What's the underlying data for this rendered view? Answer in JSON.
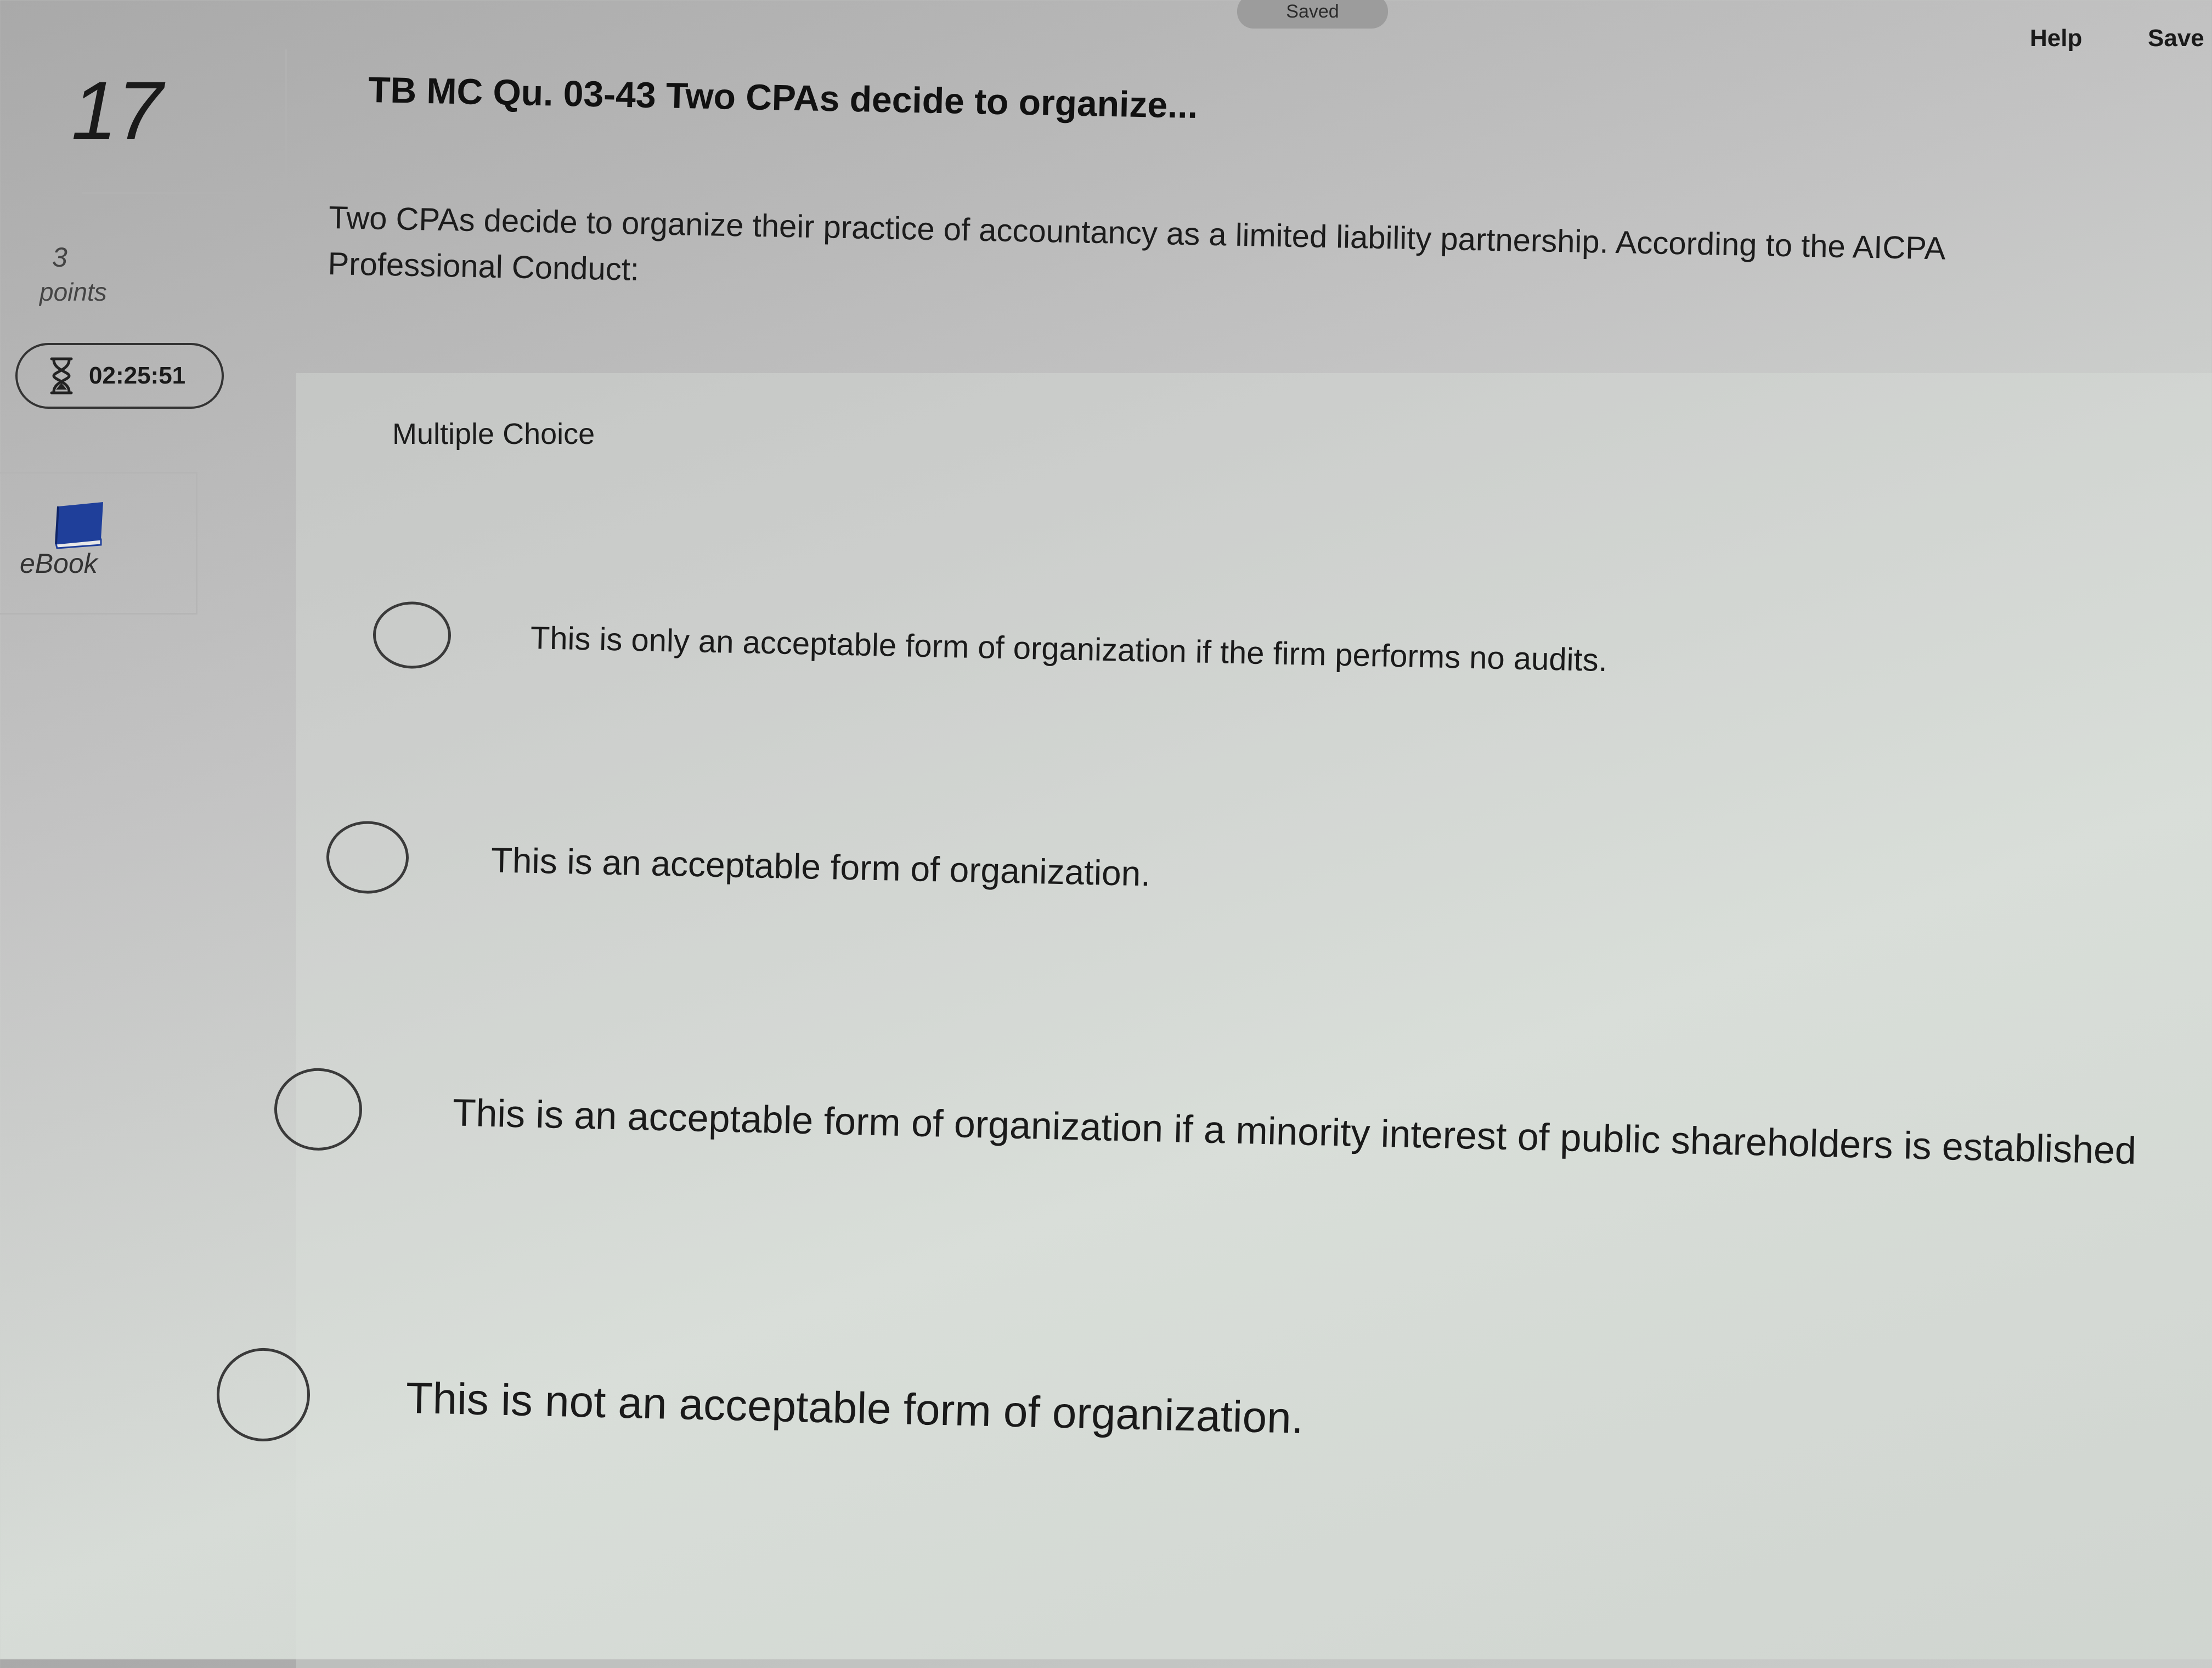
{
  "header": {
    "saved_status": "Saved",
    "help_label": "Help",
    "save_label": "Save"
  },
  "sidebar": {
    "question_number": "17",
    "points_value": "3",
    "points_label": "points",
    "timer": "02:25:51",
    "timer_icon": "hourglass-icon",
    "ebook_label": "eBook",
    "ebook_icon": "book-icon"
  },
  "question": {
    "title": "TB MC Qu. 03-43 Two CPAs decide to organize...",
    "text_line1": "Two CPAs decide to organize their practice of accountancy as a limited liability partnership. According to the AICPA",
    "text_line2": "Professional Conduct:",
    "type_label": "Multiple Choice"
  },
  "options": [
    {
      "label": "This is only an acceptable form of organization if the firm performs no audits.",
      "selected": false
    },
    {
      "label": "This is an acceptable form of organization.",
      "selected": false
    },
    {
      "label": "This is an acceptable form of organization if a minority interest of public shareholders is established",
      "selected": false
    },
    {
      "label": "This is not an acceptable form of organization.",
      "selected": false
    }
  ],
  "colors": {
    "text": "#1a1a1a",
    "ebook_icon": "#1f3f9a",
    "saved_pill": "#9c9c9c"
  }
}
